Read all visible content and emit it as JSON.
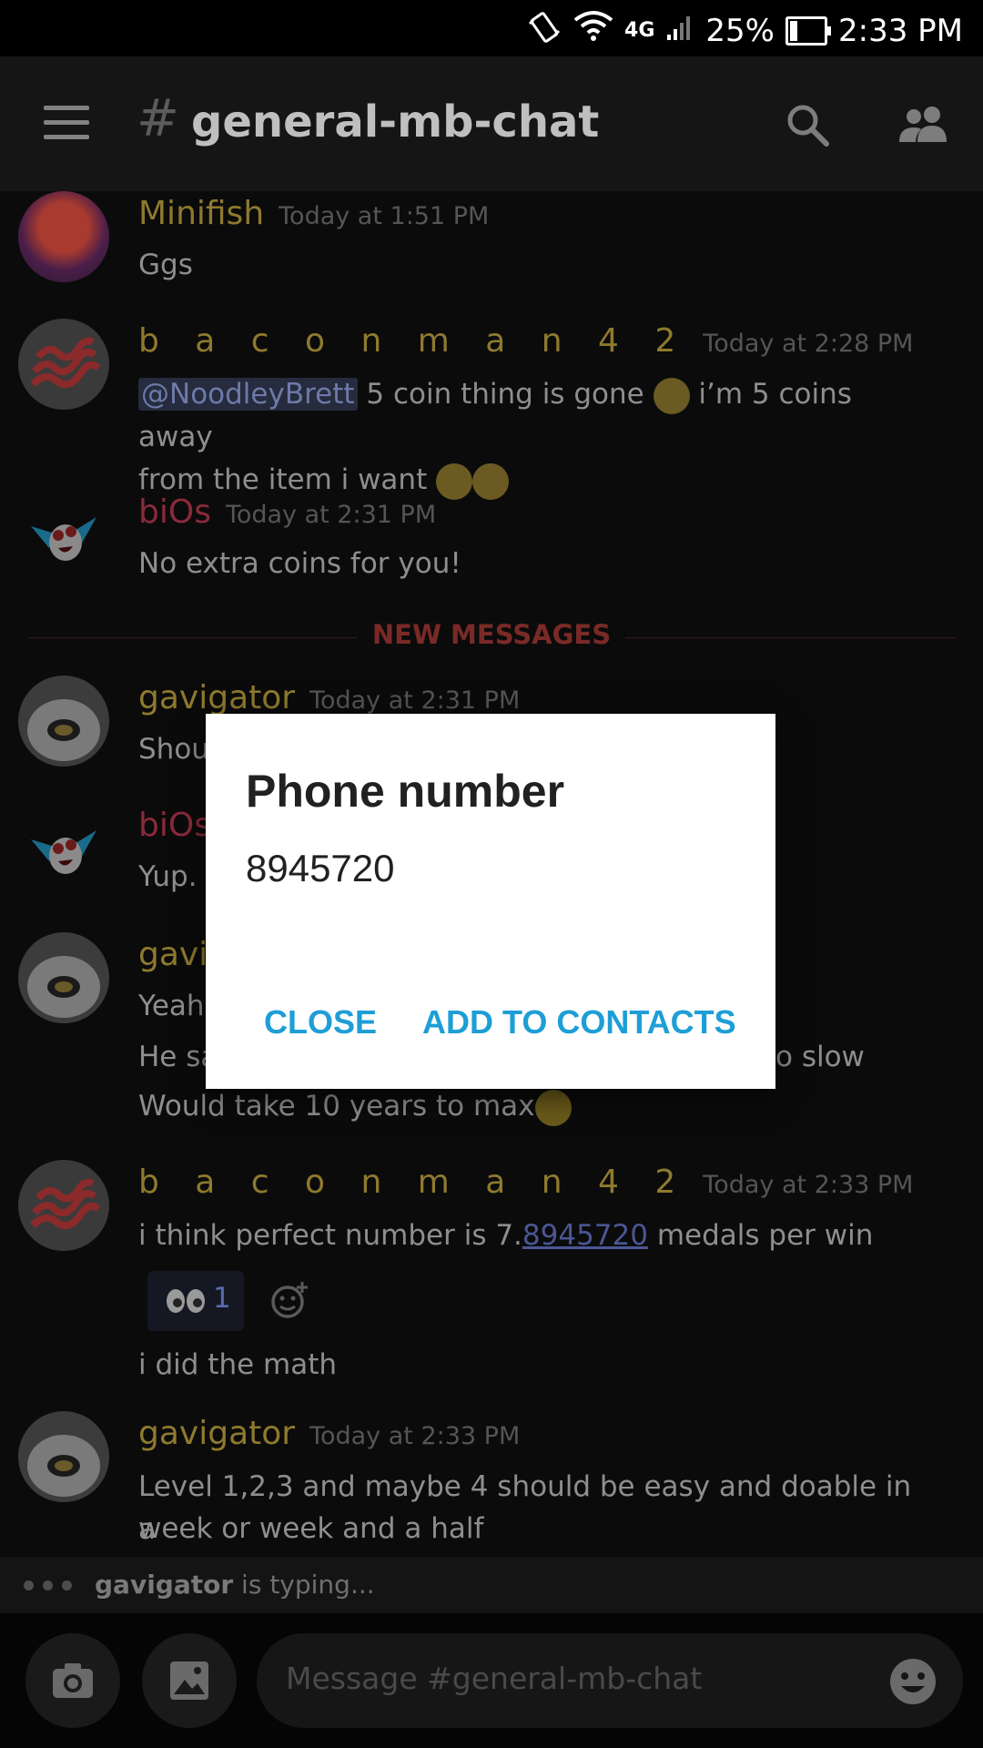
{
  "status_bar": {
    "network": "4G",
    "battery": "25%",
    "time": "2:33 PM"
  },
  "header": {
    "hash": "#",
    "channel": "general-mb-chat"
  },
  "messages": [
    {
      "author": "Minifish",
      "time": "Today at 1:51 PM",
      "lines": [
        "Ggs"
      ]
    },
    {
      "author": "b a c o n m a n 4 2",
      "time": "Today at 2:28 PM",
      "mention": "@NoodleyBrett",
      "text1": " 5 coin thing is gone ",
      "text2": " i’m 5 coins away",
      "text3": "from the item i want "
    },
    {
      "author": "biOs",
      "time": "Today at 2:31 PM",
      "lines": [
        "No extra coins for you!"
      ]
    },
    {
      "author": "gavigator",
      "time": "Today at 2:31 PM",
      "lines": [
        "Shou"
      ]
    },
    {
      "author": "biOs",
      "time": "",
      "lines": [
        "Yup."
      ]
    },
    {
      "author": "gavi",
      "time": "",
      "lines": [
        "Yeah",
        "He sa",
        "o slow",
        "Would take 10 years to max"
      ]
    },
    {
      "author": "b a c o n m a n 4 2",
      "time": "Today at 2:33 PM",
      "text_pre": "i think perfect number is 7.",
      "link": "8945720",
      "text_post": " medals per win",
      "reaction_count": "1",
      "extra": "i did the math"
    },
    {
      "author": "gavigator",
      "time": "Today at 2:33 PM",
      "lines": [
        "Level 1,2,3 and maybe 4 should be easy and doable in a",
        "week or week and a half"
      ]
    }
  ],
  "divider": "NEW MESSAGES",
  "typing": {
    "user": "gavigator",
    "text": " is typing..."
  },
  "composer": {
    "placeholder": "Message #general-mb-chat"
  },
  "dialog": {
    "title": "Phone number",
    "number": "8945720",
    "close": "CLOSE",
    "add": "ADD TO CONTACTS"
  }
}
